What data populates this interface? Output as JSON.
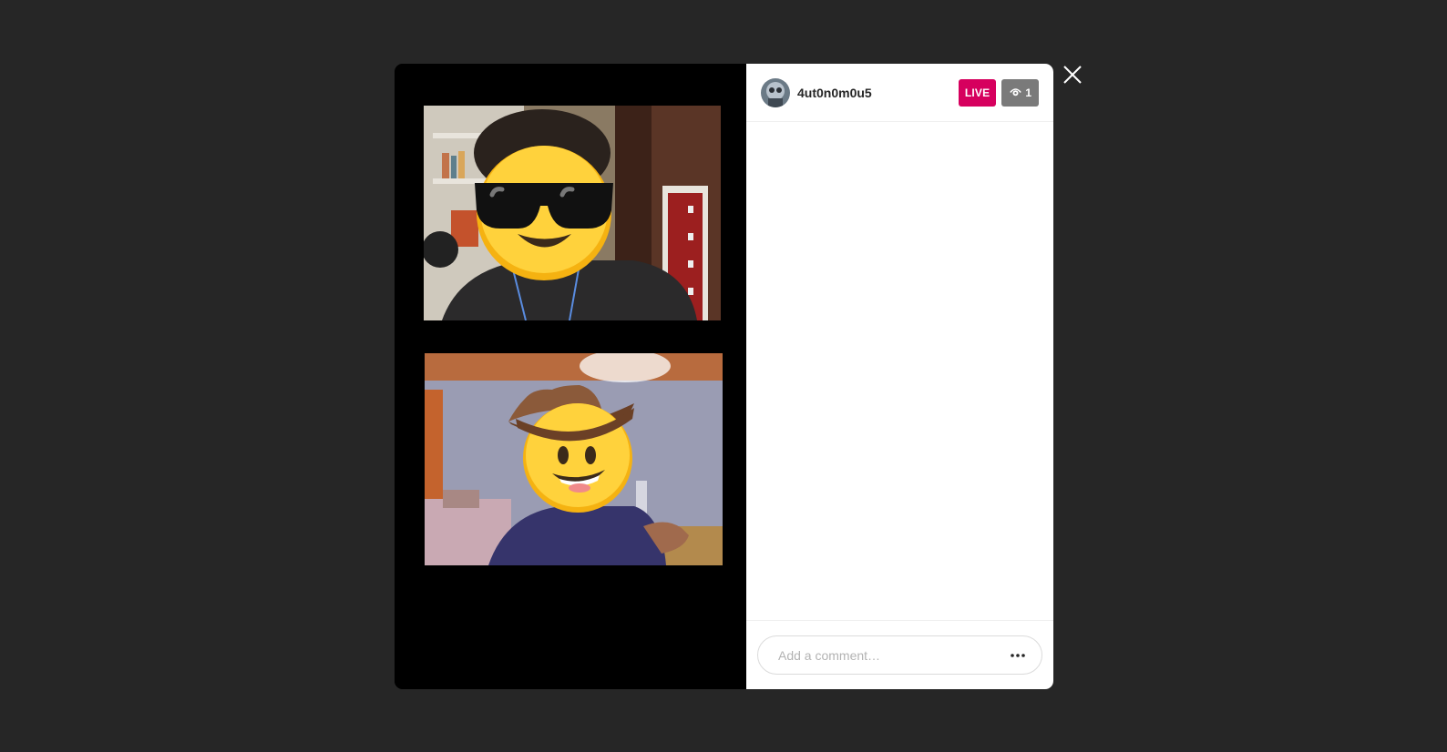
{
  "stream": {
    "username": "4ut0n0m0u5",
    "live_label": "LIVE",
    "viewer_count": "1"
  },
  "comment": {
    "placeholder": "Add a comment…"
  },
  "icons": {
    "close": "close-icon",
    "eye": "eye-icon",
    "more": "more-options-icon"
  },
  "colors": {
    "backdrop": "#262626",
    "live_badge": "#d6005e",
    "viewer_badge": "#7a7a7a"
  }
}
